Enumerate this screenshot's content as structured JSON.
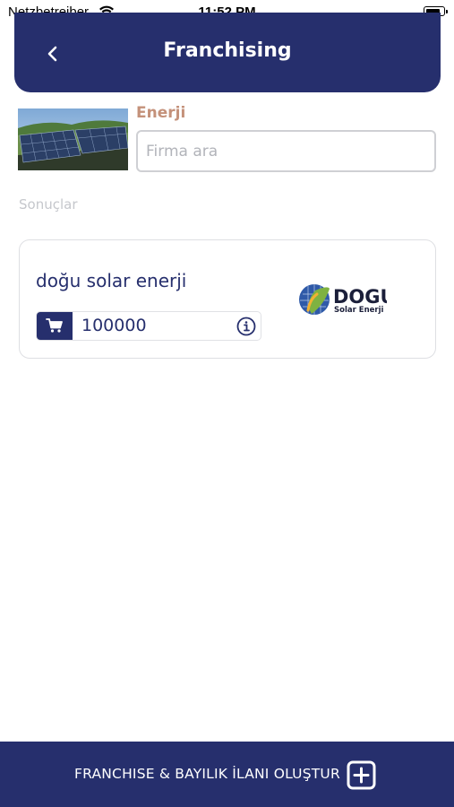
{
  "status_bar": {
    "carrier": "Netzbetreiber",
    "time": "11:52 PM"
  },
  "header": {
    "title": "Franchising",
    "back_icon": "chevron-left-icon",
    "background_color": "#262f6d"
  },
  "category": {
    "title": "Enerji",
    "image": "solar-panels-field-photo",
    "title_color": "#c4917a"
  },
  "search": {
    "placeholder": "Firma ara",
    "value": ""
  },
  "results": {
    "label": "Sonuçlar",
    "items": [
      {
        "company_name": "doğu solar enerji",
        "price": "100000",
        "price_icon": "cart-icon",
        "info_icon": "info-icon",
        "logo": {
          "name": "DOGU",
          "subtitle": "Solar Enerji"
        }
      }
    ]
  },
  "bottom_bar": {
    "label": "FRANCHISE & BAYILIK İLANI OLUŞTUR",
    "icon": "plus-square-icon"
  },
  "colors": {
    "primary": "#262f6d",
    "accent": "#c4917a",
    "muted_text": "#c5c7cc"
  }
}
